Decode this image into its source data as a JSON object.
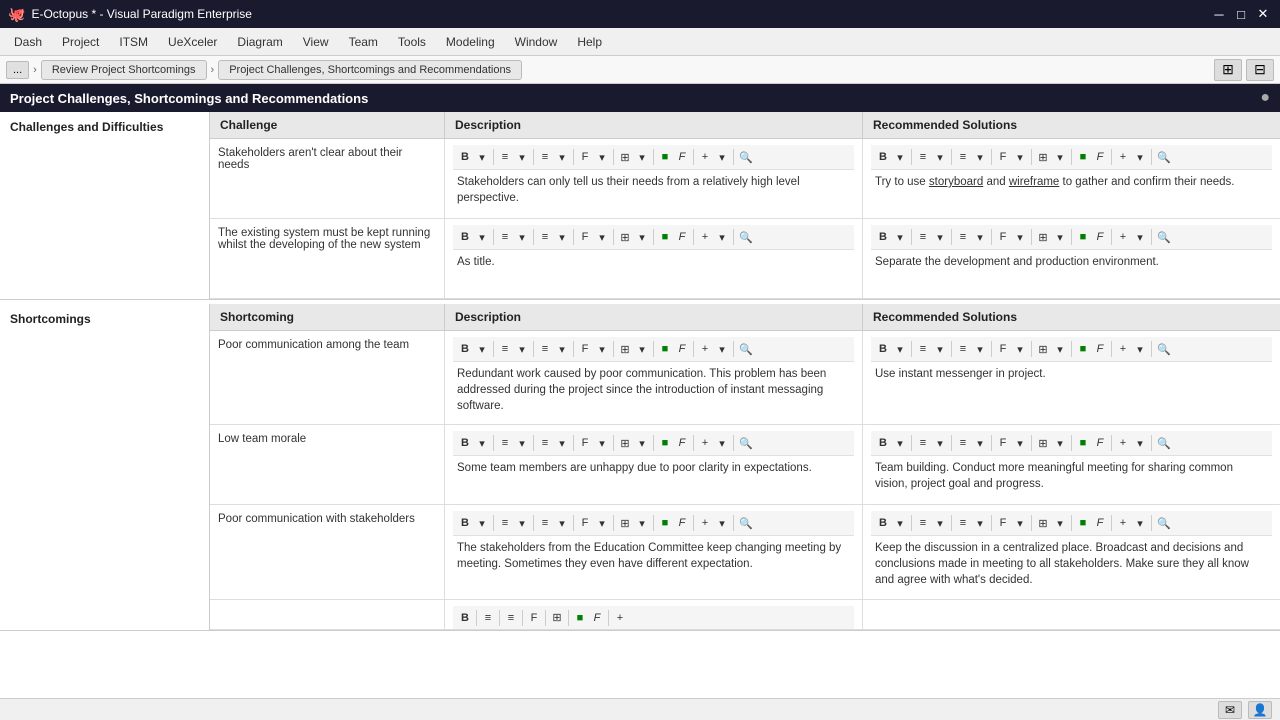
{
  "titleBar": {
    "appName": "E-Octopus * - Visual Paradigm Enterprise",
    "minimize": "─",
    "maximize": "□",
    "close": "✕"
  },
  "menuBar": {
    "items": [
      "Dash",
      "Project",
      "ITSM",
      "UeXceler",
      "Diagram",
      "View",
      "Team",
      "Tools",
      "Modeling",
      "Window",
      "Help"
    ]
  },
  "breadcrumb": {
    "backBtn": "...",
    "items": [
      "Review Project Shortcomings",
      "Project Challenges, Shortcomings and Recommendations"
    ]
  },
  "sectionTitle": "Project Challenges, Shortcomings and Recommendations",
  "sections": [
    {
      "label": "Challenges and Difficulties",
      "columns": [
        "Challenge",
        "Description",
        "Recommended Solutions"
      ],
      "rows": [
        {
          "challenge": "Stakeholders aren't clear about their needs",
          "description": "Stakeholders can only tell us their needs from a relatively high level perspective.",
          "recommended": "Try to use storyboard and wireframe to gather and confirm their needs.",
          "recUnderline": [
            "storyboard",
            "wireframe"
          ]
        },
        {
          "challenge": "The existing system must be kept running whilst the developing of the new system",
          "description": "As title.",
          "recommended": "Separate the development and production environment."
        }
      ]
    },
    {
      "label": "Shortcomings",
      "columns": [
        "Shortcoming",
        "Description",
        "Recommended Solutions"
      ],
      "rows": [
        {
          "challenge": "Poor communication among the team",
          "description": "Redundant work caused by poor communication. This problem has been addressed during the project since the introduction of instant messaging software.",
          "recommended": "Use instant messenger in project."
        },
        {
          "challenge": "Low team morale",
          "description": "Some team members are unhappy due to poor clarity in expectations.",
          "recommended": "Team building. Conduct more meaningful meeting for sharing common vision, project goal and progress."
        },
        {
          "challenge": "Poor communication with stakeholders",
          "description": "The stakeholders from the Education Committee keep changing meeting by meeting. Sometimes they even have different expectation.",
          "recommended": "Keep the discussion in a centralized place. Broadcast and decisions and conclusions made in meeting to all stakeholders. Make sure they all know and agree with what's decided."
        }
      ]
    }
  ],
  "toolbar": {
    "buttons": [
      "B",
      "▼",
      "≡",
      "▼",
      "≡",
      "▼",
      "F",
      "▼",
      "⊞",
      "▼",
      "🟩",
      "F",
      "+",
      "▼",
      "🔍"
    ]
  }
}
